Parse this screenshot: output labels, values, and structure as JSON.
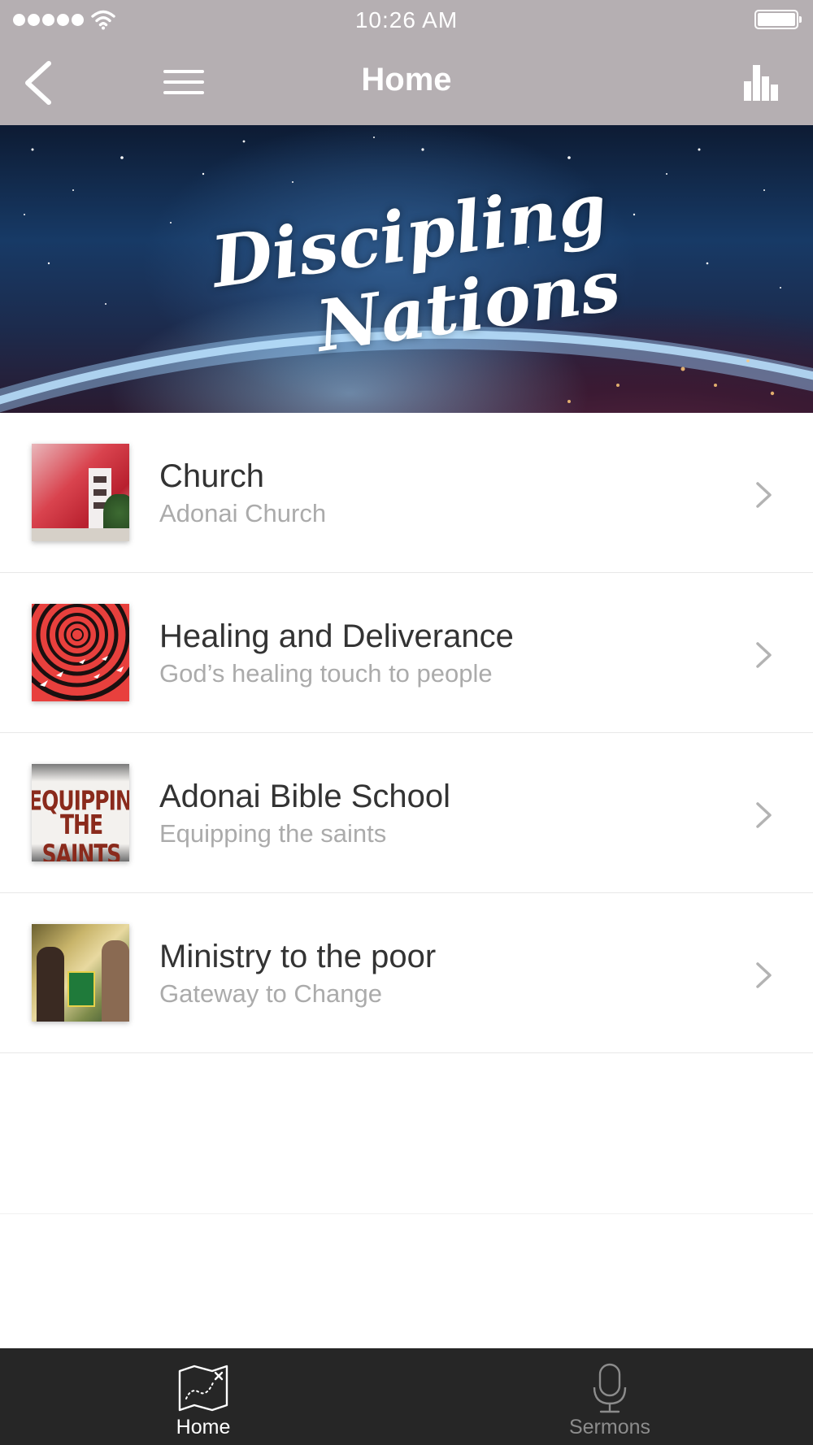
{
  "status_bar": {
    "time": "10:26 AM",
    "signal_icon": "signal-dots-icon",
    "wifi_icon": "wifi-icon",
    "battery_icon": "battery-icon",
    "battery_level": 1.0
  },
  "nav_bar": {
    "title": "Home",
    "back_icon": "chevron-left-icon",
    "menu_icon": "hamburger-menu-icon",
    "stats_icon": "bar-chart-icon",
    "background": "#b5afb2"
  },
  "banner": {
    "title_line1": "Discipling",
    "title_line2": "Nations"
  },
  "list": {
    "items": [
      {
        "title": "Church",
        "subtitle": "Adonai Church",
        "thumbnail": "church-building-photo"
      },
      {
        "title": "Healing and Deliverance",
        "subtitle": "God’s healing touch to people",
        "thumbnail": "red-circles-doves-art"
      },
      {
        "title": "Adonai Bible School",
        "subtitle": "Equipping the saints",
        "thumbnail": "equipping-the-saints-text-art",
        "thumbnail_text": [
          "EQUIPPING",
          "THE SAINTS"
        ]
      },
      {
        "title": "Ministry to the poor",
        "subtitle": "Gateway to Change",
        "thumbnail": "children-radiant-logo-photo"
      }
    ],
    "chevron_icon": "chevron-right-icon"
  },
  "tab_bar": {
    "tabs": [
      {
        "label": "Home",
        "icon": "treasure-map-icon",
        "active": true
      },
      {
        "label": "Sermons",
        "icon": "microphone-icon",
        "active": false
      }
    ],
    "active_color": "#ffffff",
    "inactive_color": "#8c8c8c"
  }
}
